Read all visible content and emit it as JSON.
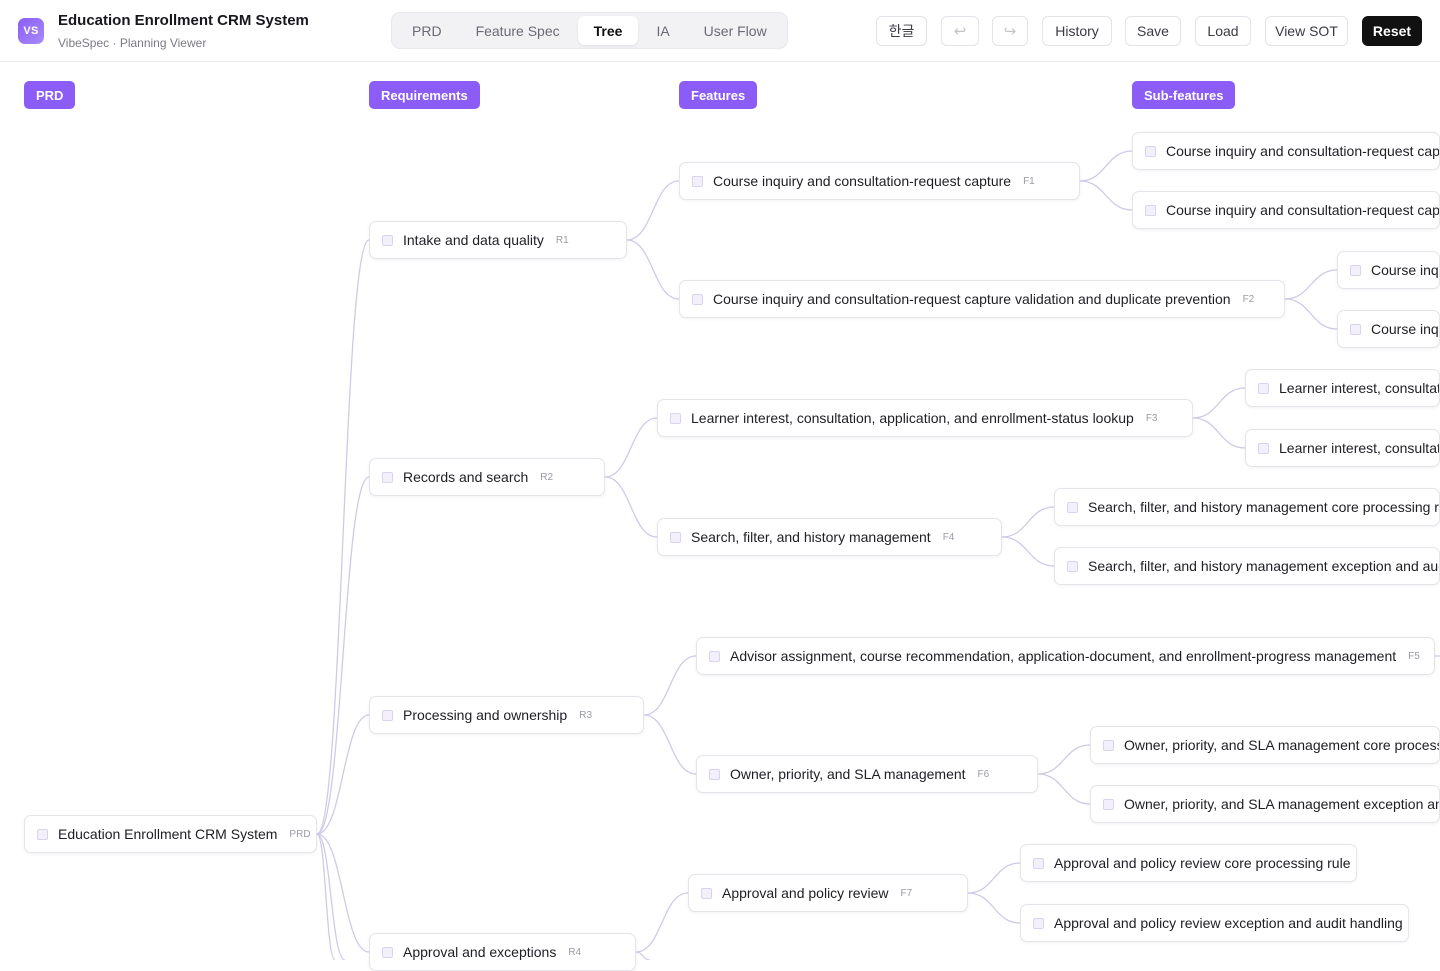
{
  "app": {
    "logo": "VS",
    "title": "Education Enrollment CRM System",
    "subtitle": "VibeSpec · Planning Viewer"
  },
  "tabs": [
    {
      "label": "PRD",
      "active": false
    },
    {
      "label": "Feature Spec",
      "active": false
    },
    {
      "label": "Tree",
      "active": true
    },
    {
      "label": "IA",
      "active": false
    },
    {
      "label": "User Flow",
      "active": false
    }
  ],
  "toolbar": {
    "language": "한글",
    "undo_icon": "undo-icon",
    "redo_icon": "redo-icon",
    "history": "History",
    "save": "Save",
    "load": "Load",
    "view_sot": "View SOT",
    "reset": "Reset"
  },
  "columns": [
    "PRD",
    "Requirements",
    "Features",
    "Sub-features"
  ],
  "tree": {
    "root": {
      "label": "Education Enrollment CRM System",
      "tag": "PRD"
    },
    "requirements": [
      {
        "label": "Intake and data quality",
        "tag": "R1"
      },
      {
        "label": "Records and search",
        "tag": "R2"
      },
      {
        "label": "Processing and ownership",
        "tag": "R3"
      },
      {
        "label": "Approval and exceptions",
        "tag": "R4"
      }
    ],
    "features": [
      {
        "label": "Course inquiry and consultation-request capture",
        "tag": "F1"
      },
      {
        "label": "Course inquiry and consultation-request capture validation and duplicate prevention",
        "tag": "F2"
      },
      {
        "label": "Learner interest, consultation, application, and enrollment-status lookup",
        "tag": "F3"
      },
      {
        "label": "Search, filter, and history management",
        "tag": "F4"
      },
      {
        "label": "Advisor assignment, course recommendation, application-document, and enrollment-progress management",
        "tag": "F5"
      },
      {
        "label": "Owner, priority, and SLA management",
        "tag": "F6"
      },
      {
        "label": "Approval and policy review",
        "tag": "F7"
      }
    ],
    "subfeatures": [
      {
        "label": "Course inquiry and consultation-request capture"
      },
      {
        "label": "Course inquiry and consultation-request capture"
      },
      {
        "label": "Course inquiry"
      },
      {
        "label": "Course inquiry"
      },
      {
        "label": "Learner interest, consultation"
      },
      {
        "label": "Learner interest, consultation"
      },
      {
        "label": "Search, filter, and history management core processing rule"
      },
      {
        "label": "Search, filter, and history management exception and audit ha"
      },
      {
        "label": "Owner, priority, and SLA management core processing r"
      },
      {
        "label": "Owner, priority, and SLA management exception and au"
      },
      {
        "label": "Approval and policy review core processing rule"
      },
      {
        "label": "Approval and policy review exception and audit handling"
      }
    ]
  }
}
